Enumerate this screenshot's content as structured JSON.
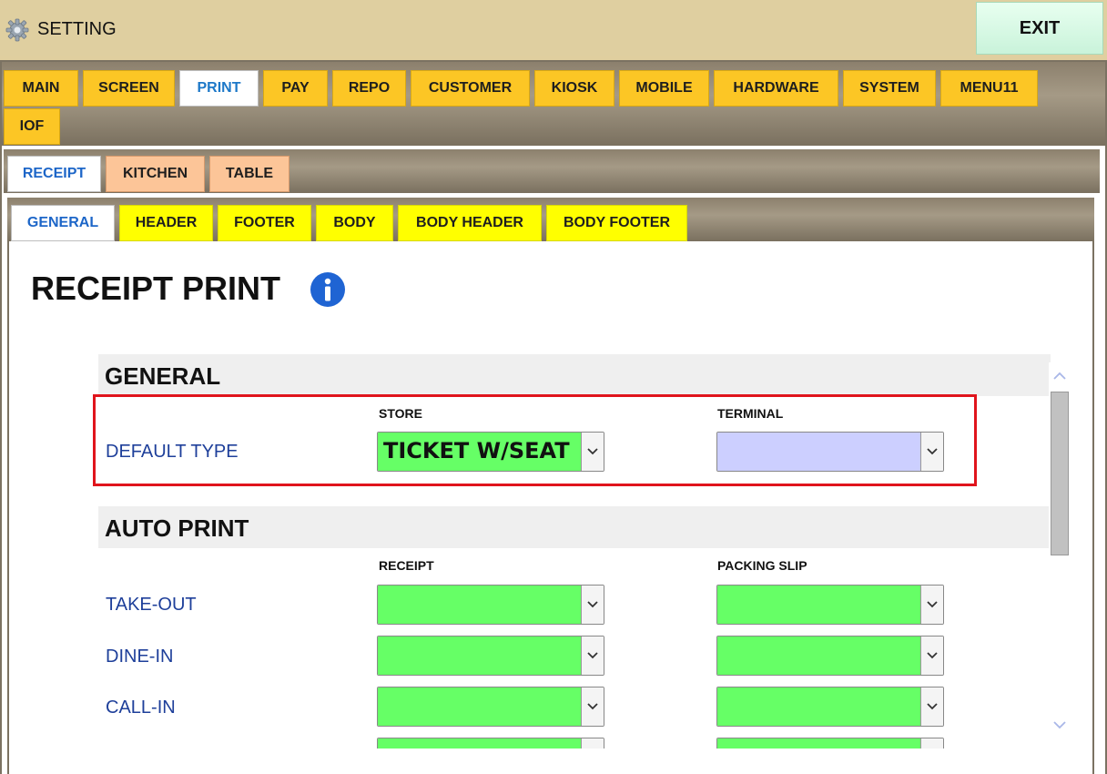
{
  "app": {
    "title": "SETTING",
    "exit_label": "EXIT"
  },
  "tabs_level1": [
    "MAIN",
    "SCREEN",
    "PRINT",
    "PAY",
    "REPO",
    "CUSTOMER",
    "KIOSK",
    "MOBILE",
    "HARDWARE",
    "SYSTEM",
    "MENU11",
    "IOF"
  ],
  "tabs_level1_active": "PRINT",
  "tabs_level2": [
    "RECEIPT",
    "KITCHEN",
    "TABLE"
  ],
  "tabs_level2_active": "RECEIPT",
  "tabs_level3": [
    "GENERAL",
    "HEADER",
    "FOOTER",
    "BODY",
    "BODY HEADER",
    "BODY FOOTER"
  ],
  "tabs_level3_active": "GENERAL",
  "page": {
    "title": "RECEIPT PRINT",
    "info_icon": "info-icon"
  },
  "sections": {
    "general": {
      "title": "GENERAL",
      "columns": [
        "STORE",
        "TERMINAL"
      ],
      "rows": [
        {
          "label": "DEFAULT TYPE",
          "store_value": "TICKET W/SEAT",
          "terminal_value": ""
        }
      ]
    },
    "auto_print": {
      "title": "AUTO PRINT",
      "columns": [
        "RECEIPT",
        "PACKING SLIP"
      ],
      "rows": [
        {
          "label": "TAKE-OUT",
          "receipt_value": "",
          "packing_value": ""
        },
        {
          "label": "DINE-IN",
          "receipt_value": "",
          "packing_value": ""
        },
        {
          "label": "CALL-IN",
          "receipt_value": "",
          "packing_value": ""
        }
      ]
    }
  },
  "colors": {
    "level1_tab": "#fcc625",
    "level2_tab": "#fcc598",
    "level3_tab": "#ffff00",
    "select_green": "#66ff66",
    "select_lavender": "#cccfff",
    "highlight_border": "#e0141c",
    "row_label": "#1e3f9a",
    "active_tab_text": "#1d78c8"
  }
}
